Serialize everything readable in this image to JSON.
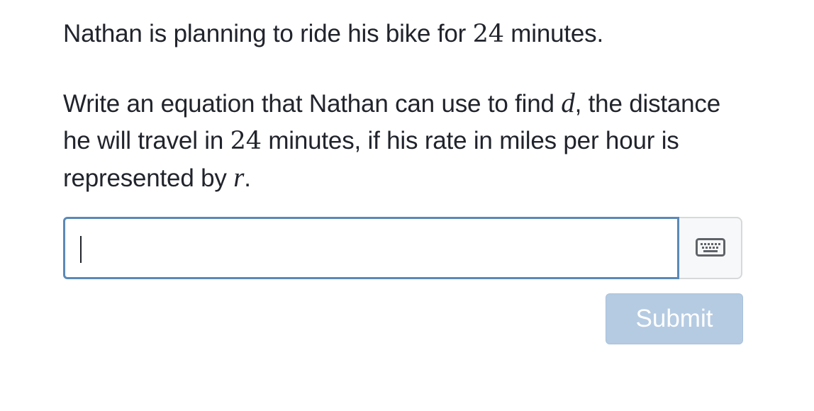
{
  "problem": {
    "line1": {
      "before": "Nathan is planning to ride his bike for ",
      "number": "24",
      "after": " minutes."
    },
    "line2": {
      "part1": "Write an equation that Nathan can use to find ",
      "var_d": "d",
      "part2": ", the distance he will travel in ",
      "number": "24",
      "part3": " minutes, if his rate in miles per hour is represented by ",
      "var_r": "r",
      "part4": "."
    }
  },
  "answer": {
    "value": ""
  },
  "icons": {
    "keypad_toggle": "keyboard-icon"
  },
  "submit": {
    "label": "Submit",
    "state": "disabled"
  },
  "colors": {
    "input_border": "#5b89b8",
    "submit_bg": "#b5cbe2",
    "text": "#21242c"
  }
}
